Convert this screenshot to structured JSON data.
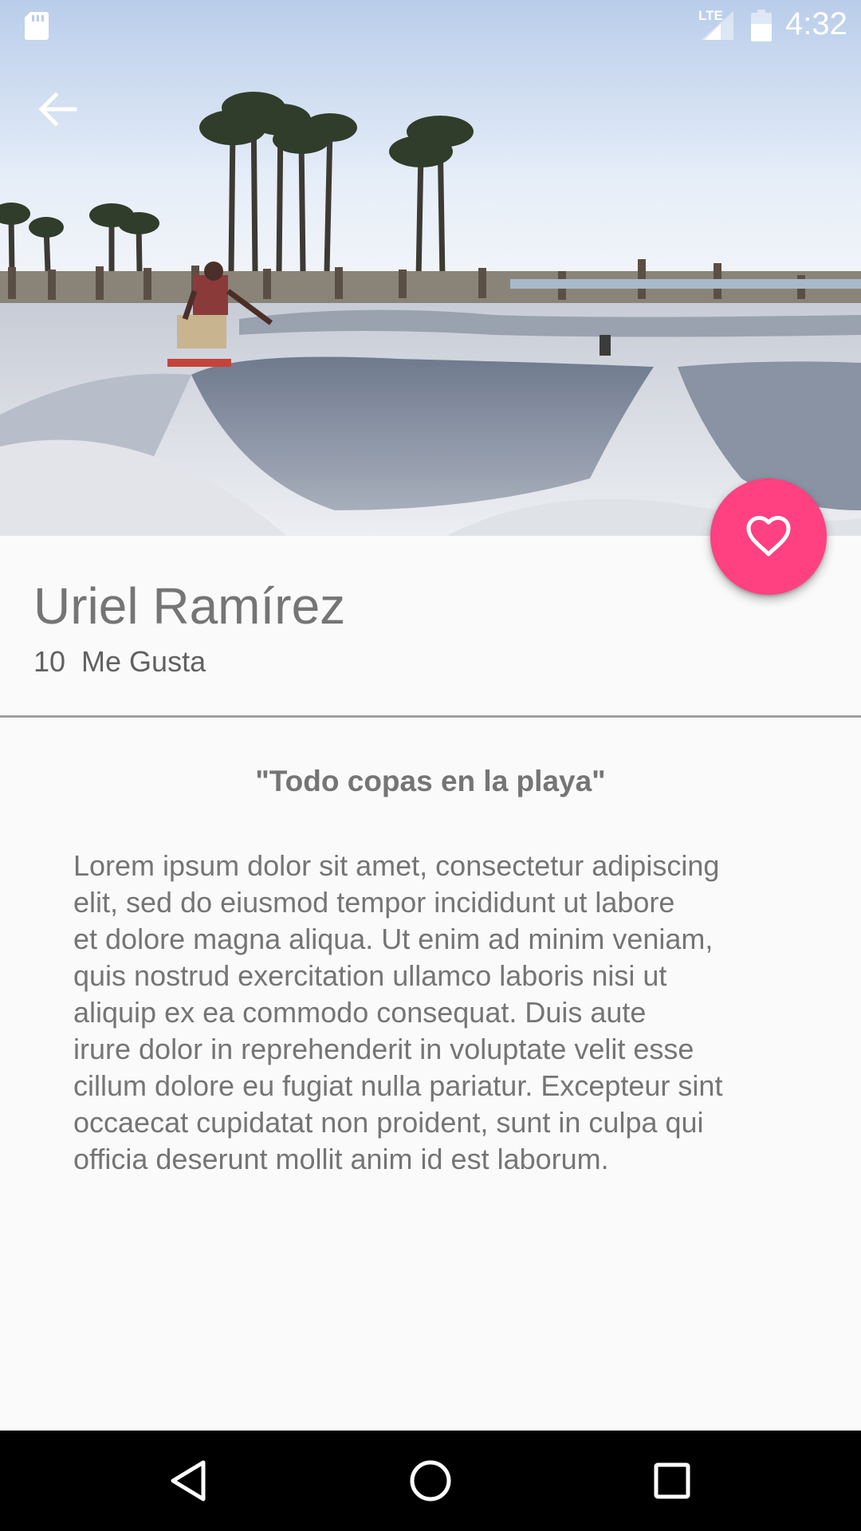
{
  "status_bar": {
    "network_label": "LTE",
    "time": "4:32",
    "icons": [
      "sd-card-icon",
      "signal-icon",
      "battery-icon"
    ]
  },
  "hero": {
    "back_icon": "arrow-back-icon"
  },
  "fab": {
    "icon": "heart-outline-icon",
    "color": "#ff4081"
  },
  "profile": {
    "name": "Uriel Ramírez",
    "likes": "10  Me Gusta"
  },
  "post": {
    "title": "\"Todo copas en la playa\"",
    "body_lines": [
      "Lorem ipsum dolor sit amet, consectetur adipiscing",
      "elit, sed do eiusmod tempor incididunt ut labore",
      "et dolore magna aliqua. Ut enim ad minim veniam,",
      "quis nostrud exercitation ullamco laboris nisi ut",
      "aliquip ex ea commodo consequat. Duis aute",
      "irure dolor in reprehenderit in voluptate velit esse",
      "cillum dolore eu fugiat nulla pariatur. Excepteur sint",
      "occaecat cupidatat non proident, sunt in culpa qui",
      "officia deserunt mollit anim id est laborum."
    ]
  },
  "nav_bar": {
    "buttons": [
      "back-triangle-icon",
      "home-circle-icon",
      "recents-square-icon"
    ]
  },
  "colors": {
    "accent": "#ff4081",
    "background": "#fafafa",
    "text_secondary": "#757575"
  }
}
